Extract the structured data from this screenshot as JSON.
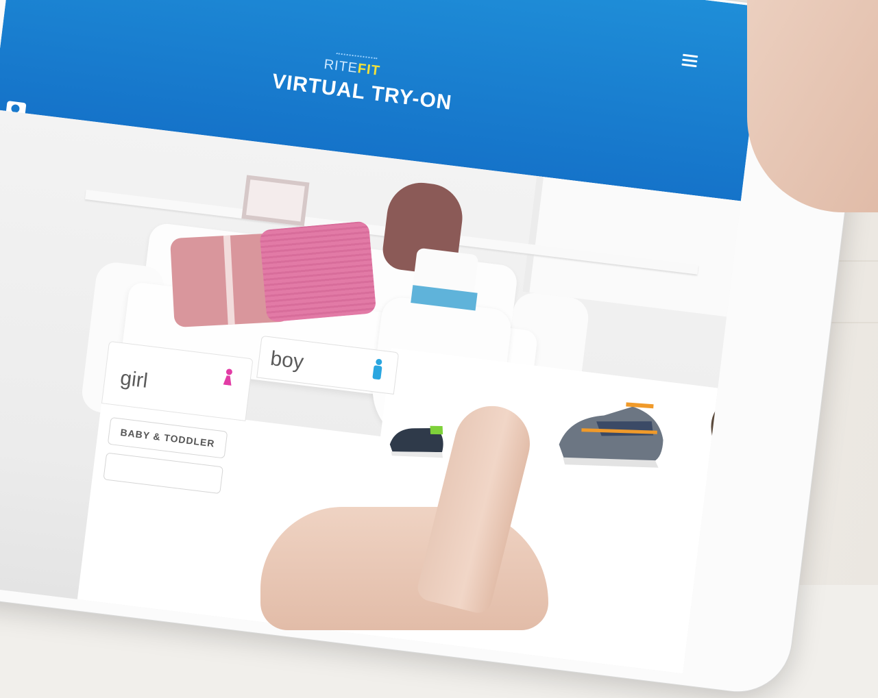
{
  "app": {
    "brand_prefix": "RITE",
    "brand_suffix": "FIT",
    "title": "VIRTUAL TRY-ON"
  },
  "header": {
    "menu_icon": "hamburger-menu-icon",
    "camera_icon": "camera-icon"
  },
  "tabs": [
    {
      "label": "boy",
      "icon": "boy-icon",
      "color": "#2aa6e0"
    },
    {
      "label": "girl",
      "icon": "girl-icon",
      "color": "#e23ca5"
    }
  ],
  "categories": [
    {
      "label": "BABY & TODDLER"
    },
    {
      "label": ""
    }
  ],
  "colors": {
    "header_blue": "#1879cc",
    "brand_yellow": "#f3e23a"
  }
}
